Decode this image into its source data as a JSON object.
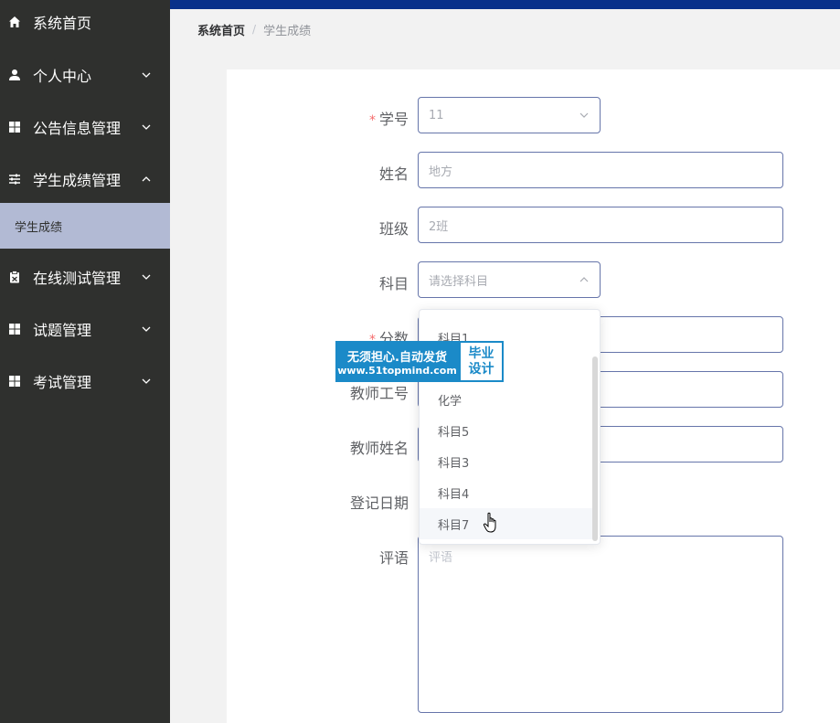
{
  "sidebar": {
    "items": [
      {
        "label": "系统首页",
        "icon": "home-icon"
      },
      {
        "label": "个人中心",
        "icon": "user-icon"
      },
      {
        "label": "公告信息管理",
        "icon": "grid-icon"
      },
      {
        "label": "学生成绩管理",
        "icon": "sliders-icon"
      },
      {
        "label": "在线测试管理",
        "icon": "clipboard-icon"
      },
      {
        "label": "试题管理",
        "icon": "grid-icon"
      },
      {
        "label": "考试管理",
        "icon": "grid-icon"
      }
    ],
    "submenu": {
      "label": "学生成绩"
    }
  },
  "breadcrumb": {
    "home": "系统首页",
    "separator": "/",
    "current": "学生成绩"
  },
  "form": {
    "student_no": {
      "label": "学号",
      "value": "11"
    },
    "name": {
      "label": "姓名",
      "value": "地方"
    },
    "class": {
      "label": "班级",
      "value": "2班"
    },
    "subject": {
      "label": "科目",
      "placeholder": "请选择科目"
    },
    "score": {
      "label": "分数"
    },
    "teacher_no": {
      "label": "教师工号"
    },
    "teacher_name": {
      "label": "教师姓名"
    },
    "date": {
      "label": "登记日期"
    },
    "comment": {
      "label": "评语",
      "placeholder": "评语"
    }
  },
  "dropdown": {
    "options": [
      "科目1",
      "化学",
      "科目5",
      "科目3",
      "科目4",
      "科目7"
    ],
    "hovered": "科目7"
  },
  "watermark": {
    "line1": "无须担心.自动发货",
    "line2": "www.51topmind.com",
    "badge1": "毕业",
    "badge2": "设计"
  },
  "colors": {
    "sidebar_bg": "#2f302e",
    "active_submenu": "#b2bad4",
    "topbar": "#08308a",
    "input_border": "#6675aa",
    "required": "#f56c6c"
  }
}
